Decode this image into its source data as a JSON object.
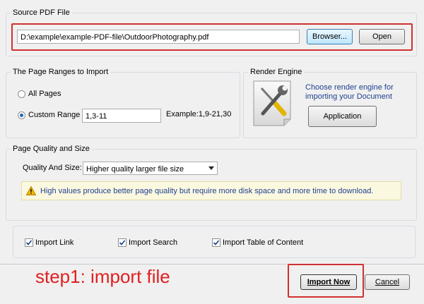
{
  "source": {
    "title": "Source PDF File",
    "path": "D:\\example\\example-PDF-file\\OutdoorPhotography.pdf",
    "browse_label": "Browser...",
    "open_label": "Open"
  },
  "ranges": {
    "title": "The Page Ranges to Import",
    "all_pages": "All Pages",
    "custom_range": "Custom Range",
    "custom_value": "1,3-11",
    "example": "Example:1,9-21,30"
  },
  "engine": {
    "title": "Render Engine",
    "description": "Choose render engine for importing your Document",
    "button_label": "Application",
    "icon": "tools-icon"
  },
  "quality": {
    "title": "Page Quality and Size",
    "label": "Quality And Size:",
    "selected": "Higher quality larger file size",
    "notice": "High values produce better page quality but require more disk space and more time to download."
  },
  "options": {
    "import_link": "Import Link",
    "import_search": "Import Search",
    "import_toc": "Import Table of Content"
  },
  "annotation": "step1: import file",
  "footer": {
    "import_label": "Import Now",
    "cancel_label": "Cancel"
  },
  "colors": {
    "annotation_red": "#e02020",
    "link_blue": "#1f3f8f",
    "notice_bg": "#fbf8e0"
  }
}
